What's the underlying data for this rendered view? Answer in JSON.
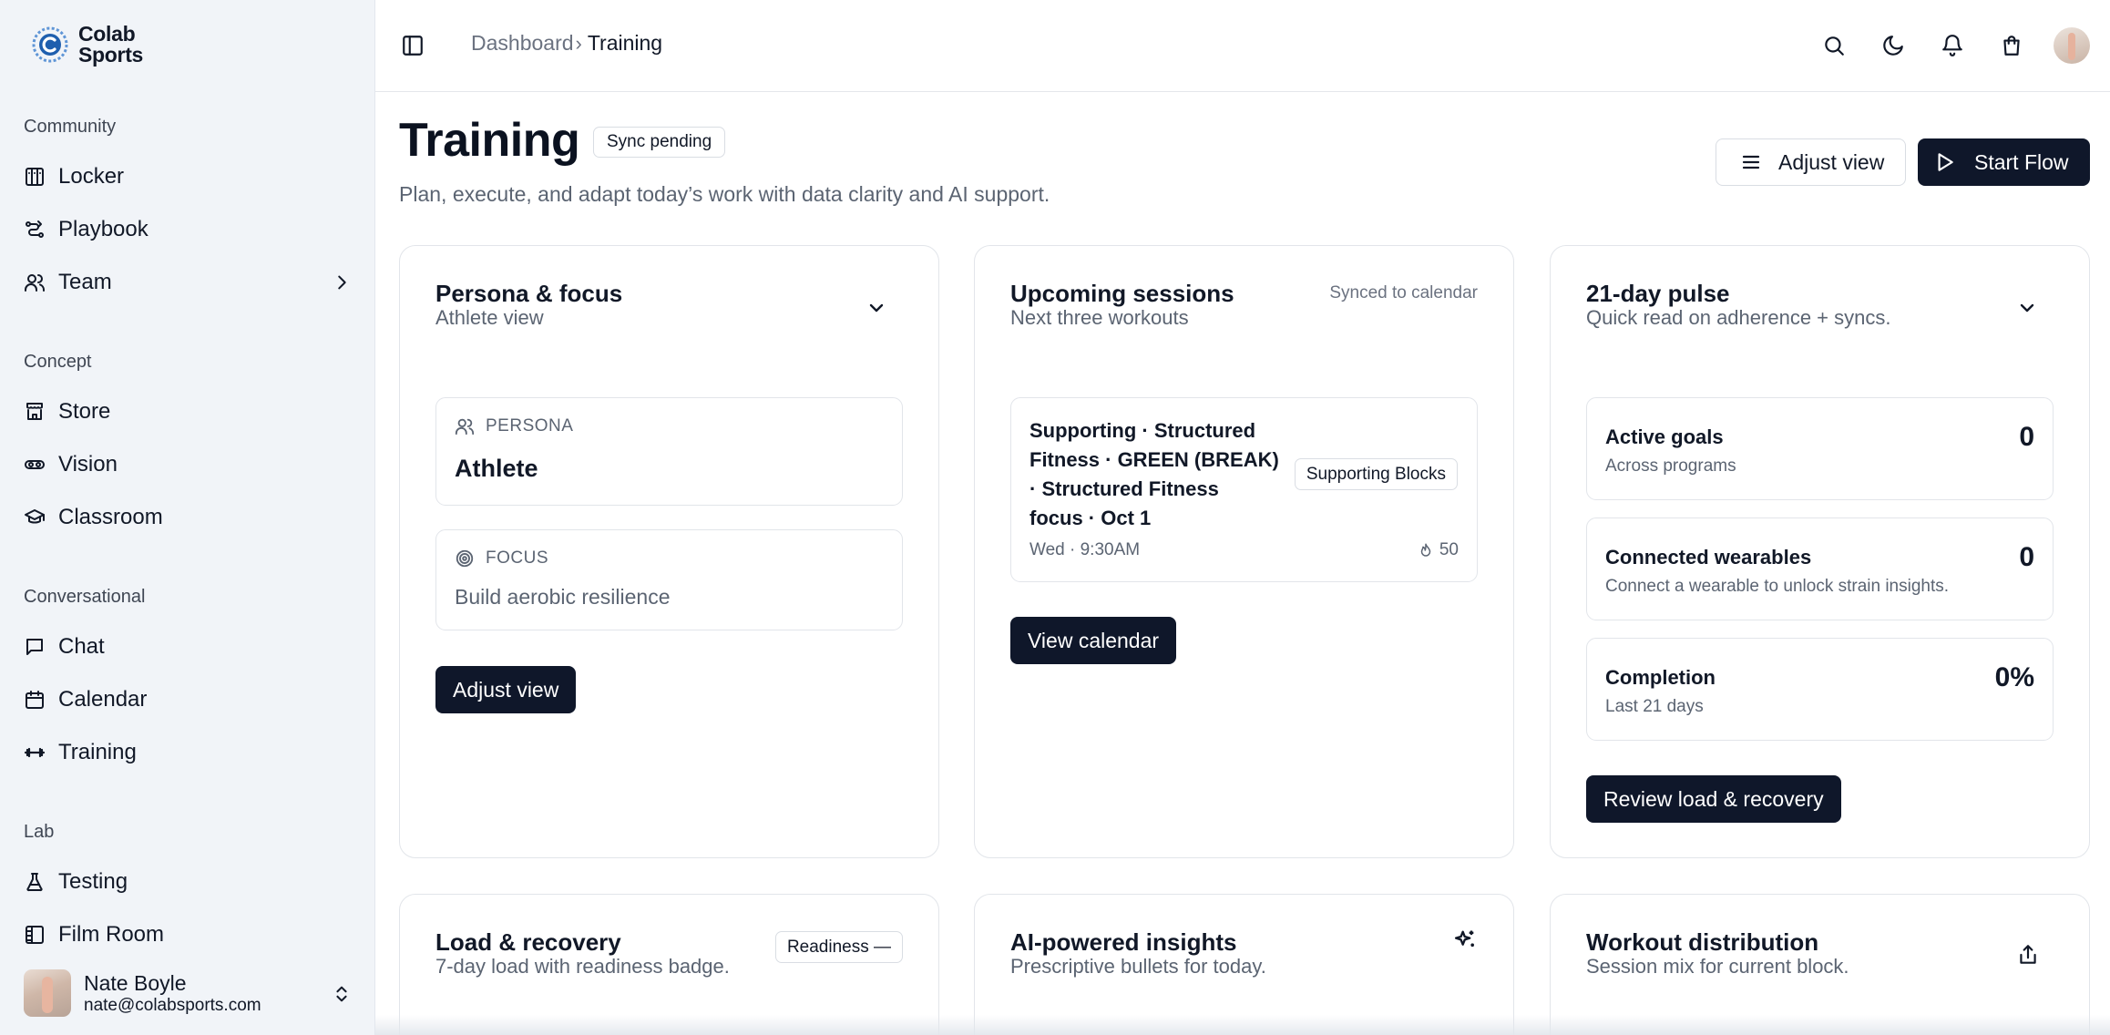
{
  "brand": {
    "name_line1": "Colab",
    "name_line2": "Sports"
  },
  "sidebar": {
    "sections": [
      {
        "title": "Community",
        "items": [
          {
            "label": "Locker",
            "icon": "locker-icon"
          },
          {
            "label": "Playbook",
            "icon": "playbook-icon"
          },
          {
            "label": "Team",
            "icon": "team-icon",
            "has_chevron": true
          }
        ]
      },
      {
        "title": "Concept",
        "items": [
          {
            "label": "Store",
            "icon": "store-icon"
          },
          {
            "label": "Vision",
            "icon": "vision-icon"
          },
          {
            "label": "Classroom",
            "icon": "classroom-icon"
          }
        ]
      },
      {
        "title": "Conversational",
        "items": [
          {
            "label": "Chat",
            "icon": "chat-icon"
          },
          {
            "label": "Calendar",
            "icon": "calendar-icon"
          },
          {
            "label": "Training",
            "icon": "dumbbell-icon"
          }
        ]
      },
      {
        "title": "Lab",
        "items": [
          {
            "label": "Testing",
            "icon": "flask-icon"
          },
          {
            "label": "Film Room",
            "icon": "film-icon"
          }
        ]
      }
    ],
    "user": {
      "name": "Nate Boyle",
      "email": "nate@colabsports.com"
    }
  },
  "topbar": {
    "breadcrumb": {
      "parent": "Dashboard",
      "separator": "›",
      "current": "Training"
    },
    "icons": [
      "search-icon",
      "moon-icon",
      "bell-icon",
      "shopping-bag-icon",
      "avatar"
    ]
  },
  "header": {
    "title": "Training",
    "badge": "Sync pending",
    "subtitle": "Plan, execute, and adapt today’s work with data clarity and AI support.",
    "adjust_view_label": "Adjust view",
    "start_flow_label": "Start Flow"
  },
  "persona_card": {
    "title": "Persona & focus",
    "subtitle": "Athlete view",
    "persona_label": "PERSONA",
    "persona_value": "Athlete",
    "focus_label": "FOCUS",
    "focus_value": "Build aerobic resilience",
    "button_label": "Adjust view"
  },
  "sessions_card": {
    "title": "Upcoming sessions",
    "subtitle": "Next three workouts",
    "status": "Synced to calendar",
    "session": {
      "line1": "Supporting · Structured",
      "line2": "Fitness · GREEN (BREAK)",
      "line3": "· Structured Fitness",
      "line4": "focus · Oct 1",
      "time": "Wed · 9:30AM",
      "tag": "Supporting Blocks",
      "load": "50"
    },
    "button_label": "View calendar"
  },
  "pulse_card": {
    "title": "21-day pulse",
    "subtitle": "Quick read on adherence + syncs.",
    "metrics": [
      {
        "title": "Active goals",
        "sub": "Across programs",
        "value": "0"
      },
      {
        "title": "Connected wearables",
        "sub": "Connect a wearable to unlock strain insights.",
        "value": "0"
      },
      {
        "title": "Completion",
        "sub": "Last 21 days",
        "value": "0%"
      }
    ],
    "button_label": "Review load & recovery"
  },
  "load_card": {
    "title": "Load & recovery",
    "subtitle": "7-day load with readiness badge.",
    "badge": "Readiness —"
  },
  "insights_card": {
    "title": "AI-powered insights",
    "subtitle": "Prescriptive bullets for today."
  },
  "distribution_card": {
    "title": "Workout distribution",
    "subtitle": "Session mix for current block."
  }
}
